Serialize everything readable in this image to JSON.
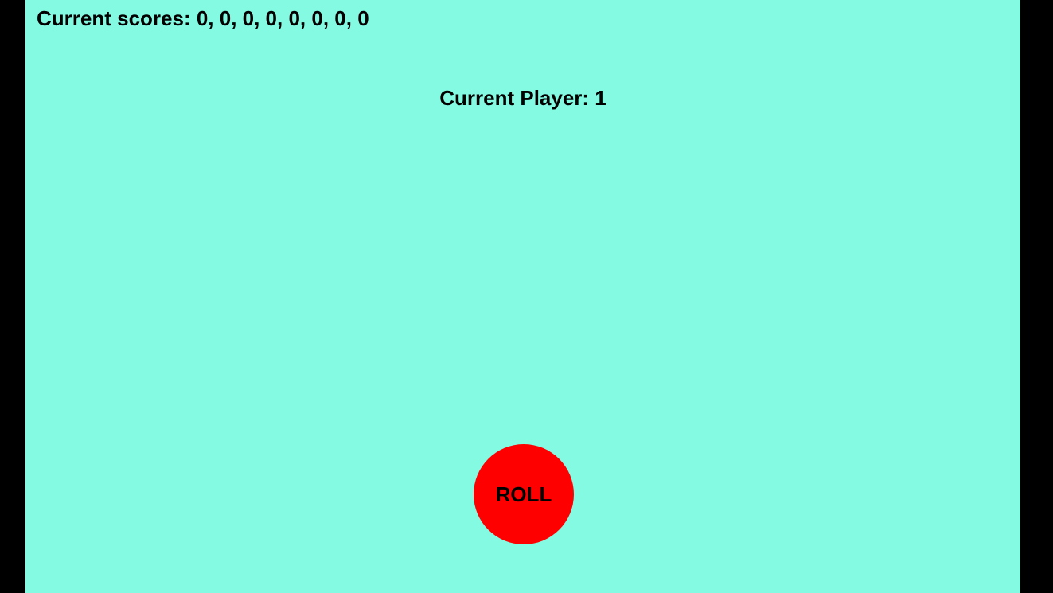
{
  "game": {
    "scores_label": "Current scores: 0, 0, 0, 0, 0, 0, 0, 0",
    "scores": [
      0,
      0,
      0,
      0,
      0,
      0,
      0,
      0
    ],
    "current_player_label": "Current Player: 1",
    "current_player": 1,
    "roll_button_label": "ROLL"
  },
  "colors": {
    "canvas_background": "#84FAE2",
    "side_bars": "#000000",
    "roll_button": "#FF0000",
    "text": "#000000"
  }
}
